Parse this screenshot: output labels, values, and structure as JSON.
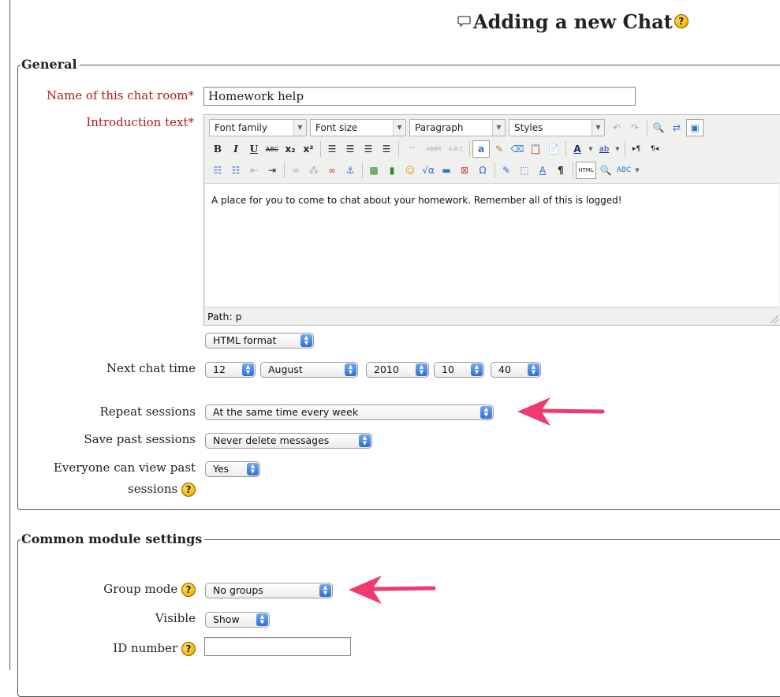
{
  "page": {
    "title": "Adding a new Chat",
    "help_symbol": "?"
  },
  "general": {
    "legend": "General",
    "name_label": "Name of this chat room*",
    "name_value": "Homework help",
    "intro_label": "Introduction text*",
    "editor": {
      "font_family": "Font family",
      "font_size": "Font size",
      "paragraph": "Paragraph",
      "styles": "Styles",
      "content": "A place for you to come to chat about your homework. Remember all of this is logged!",
      "path": "Path: p",
      "format": "HTML format"
    },
    "next_chat_label": "Next chat time",
    "next_chat": {
      "day": "12",
      "month": "August",
      "year": "2010",
      "hour": "10",
      "minute": "40"
    },
    "repeat_label": "Repeat sessions",
    "repeat_value": "At the same time every week",
    "save_label": "Save past sessions",
    "save_value": "Never delete messages",
    "everyone_label_1": "Everyone can view past",
    "everyone_label_2": "sessions",
    "everyone_value": "Yes"
  },
  "common": {
    "legend": "Common module settings",
    "group_label": "Group mode",
    "group_value": "No groups",
    "visible_label": "Visible",
    "visible_value": "Show",
    "id_label": "ID number",
    "id_value": ""
  },
  "colors": {
    "required_label": "#b01b1b",
    "arrow": "#ee3a6c",
    "select_arrows": "#2f6fd6"
  }
}
